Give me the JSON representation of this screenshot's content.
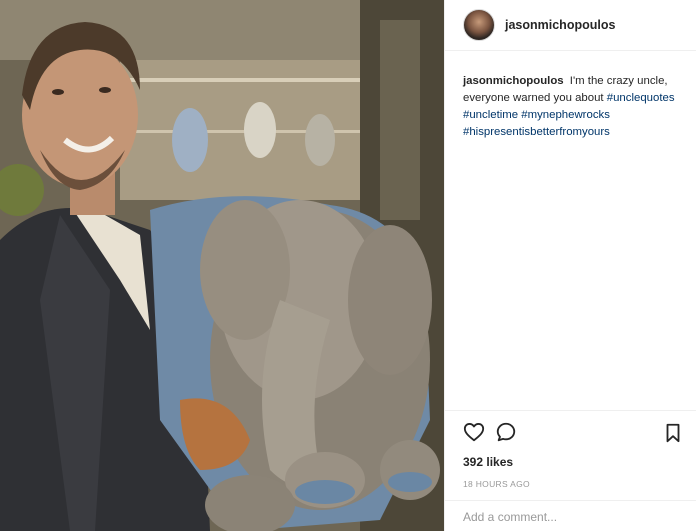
{
  "post": {
    "username": "jasonmichopoulos",
    "caption": {
      "username": "jasonmichopoulos",
      "text": "I'm the crazy uncle, everyone warned you about",
      "hashtags": [
        "#unclequotes",
        "#uncletime",
        "#mynephewrocks",
        "#hispresentisbetterfromyours"
      ]
    },
    "likes": "392 likes",
    "timestamp": "18 HOURS AGO",
    "comment": {
      "placeholder": "Add a comment..."
    },
    "icons": {
      "like": "heart-icon",
      "comment": "comment-icon",
      "save": "bookmark-icon"
    },
    "colors": {
      "hashtag": "#003569",
      "text": "#262626",
      "muted": "#999999",
      "divider": "#efefef"
    }
  }
}
